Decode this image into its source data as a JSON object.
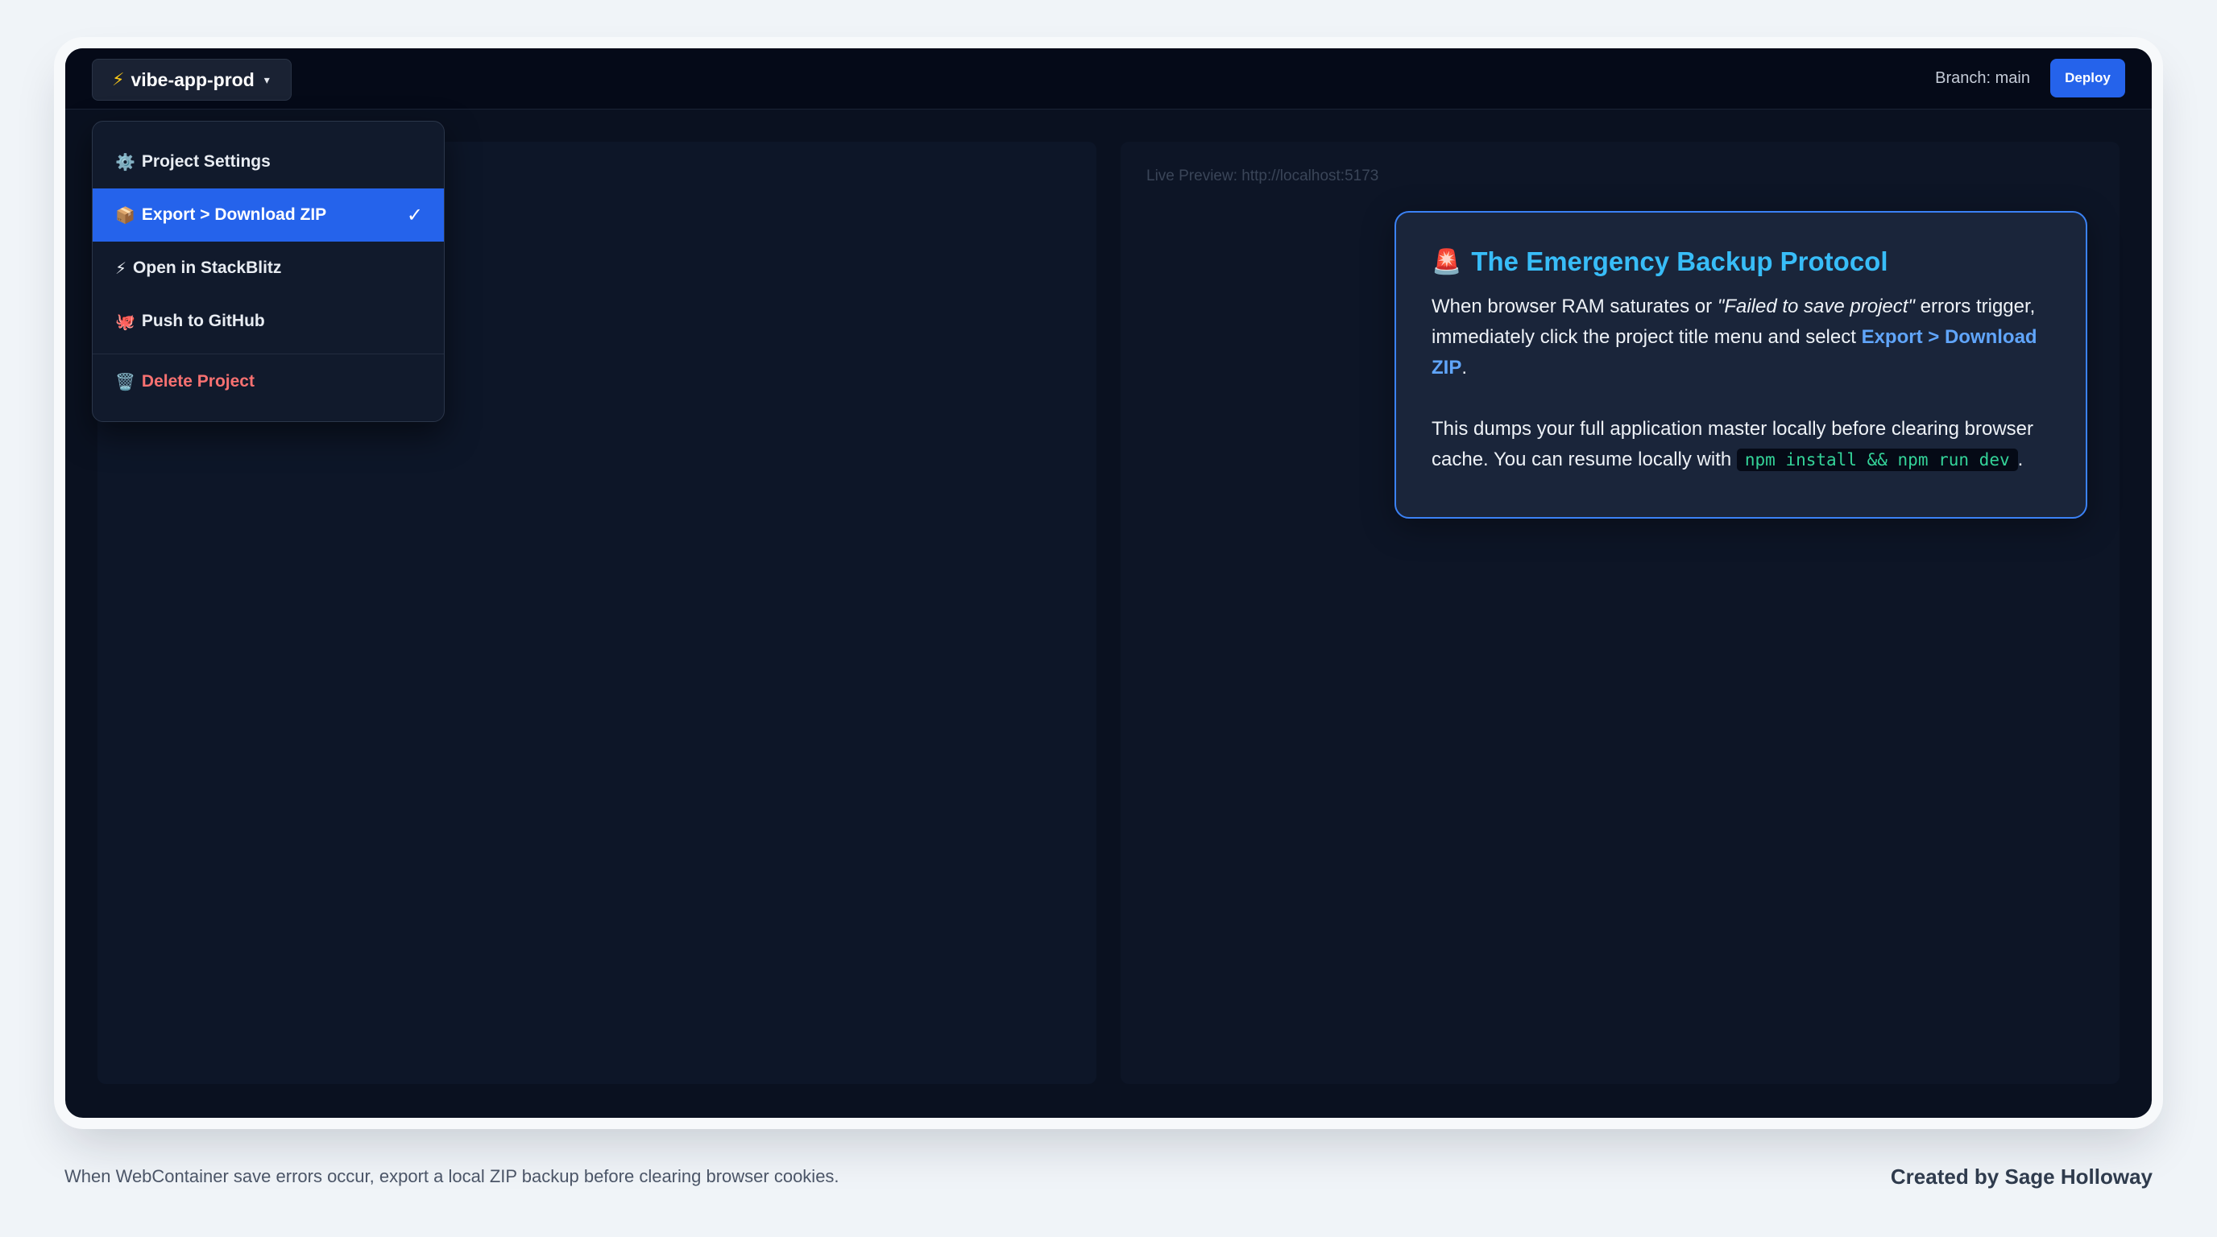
{
  "topbar": {
    "project_icon": "⚡",
    "project_name": "vibe-app-prod",
    "caret": "▾",
    "branch": "Branch: main",
    "deploy_label": "Deploy"
  },
  "menu": {
    "items": [
      {
        "icon": "⚙️",
        "icon_name": "gear-icon",
        "label": "Project Settings"
      },
      {
        "icon": "📦",
        "icon_name": "package-icon",
        "label": "Export > Download ZIP",
        "check": "✓"
      },
      {
        "icon": "⚡",
        "icon_name": "bolt-icon",
        "label": "Open in StackBlitz"
      },
      {
        "icon": "🐙",
        "icon_name": "octopus-icon",
        "label": "Push to GitHub"
      },
      {
        "icon": "🗑️",
        "icon_name": "trash-icon",
        "label": "Delete Project"
      }
    ]
  },
  "preview": {
    "label": "Live Preview: http://localhost:5173"
  },
  "card": {
    "icon": "🚨",
    "title": "The Emergency Backup Protocol",
    "p1_a": "When browser RAM saturates or ",
    "p1_em": "\"Failed to save project\"",
    "p1_b": " errors trigger, immediately click the project title menu and select ",
    "p1_hl": "Export > Download ZIP",
    "p1_c": ".",
    "p2_a": "This dumps your full application master locally before clearing browser cache. You can resume locally with ",
    "p2_code": "npm install && npm run dev",
    "p2_b": "."
  },
  "footer": {
    "left": "When WebContainer save errors occur, export a local ZIP backup before clearing browser cookies.",
    "right": "Created by Sage Holloway"
  },
  "colors": {
    "accent": "#2563eb",
    "title": "#38bdf8",
    "danger": "#f87171",
    "code": "#34d399"
  }
}
